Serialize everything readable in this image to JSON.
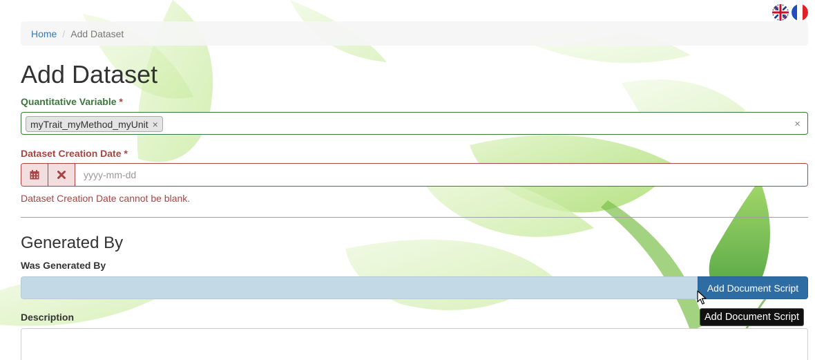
{
  "languages": [
    {
      "name": "English",
      "icon": "uk-flag-icon"
    },
    {
      "name": "Français",
      "icon": "france-flag-icon"
    }
  ],
  "breadcrumb": {
    "home": "Home",
    "separator": "/",
    "current": "Add Dataset"
  },
  "page_title": "Add Dataset",
  "form": {
    "quantitative_variable": {
      "label": "Quantitative Variable",
      "required_mark": "*",
      "selected_tag": "myTrait_myMethod_myUnit",
      "tag_remove": "×",
      "clear": "×"
    },
    "creation_date": {
      "label": "Dataset Creation Date",
      "required_mark": "*",
      "placeholder": "yyyy-mm-dd",
      "error": "Dataset Creation Date cannot be blank."
    },
    "generated_by_section": "Generated By",
    "was_generated_by": {
      "label": "Was Generated By",
      "button": "Add Document Script",
      "tooltip": "Add Document Script"
    },
    "description": {
      "label": "Description"
    }
  },
  "colors": {
    "success": "#3c763d",
    "error": "#a94442",
    "primary": "#2e6da4",
    "link": "#337ab7"
  }
}
